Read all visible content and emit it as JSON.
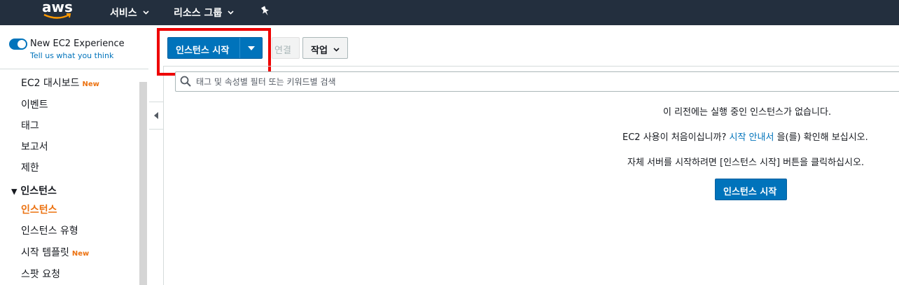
{
  "topnav": {
    "logo_text": "aws",
    "services_label": "서비스",
    "resource_groups_label": "리소스 그룹"
  },
  "sidebar": {
    "new_experience_label": "New EC2 Experience",
    "tell_us_label": "Tell us what you think",
    "items": [
      {
        "label": "EC2 대시보드",
        "badge": "New"
      },
      {
        "label": "이벤트"
      },
      {
        "label": "태그"
      },
      {
        "label": "보고서"
      },
      {
        "label": "제한"
      }
    ],
    "section_label": "인스턴스",
    "section_items": [
      {
        "label": "인스턴스",
        "active": true
      },
      {
        "label": "인스턴스 유형"
      },
      {
        "label": "시작 템플릿",
        "badge": "New"
      },
      {
        "label": "스팟 요청"
      }
    ]
  },
  "toolbar": {
    "launch_label": "인스턴스 시작",
    "connect_label": "연결",
    "actions_label": "작업"
  },
  "search": {
    "placeholder": "태그 및 속성별 필터 또는 키워드별 검색"
  },
  "empty_state": {
    "line1": "이 리전에는 실행 중인 인스턴스가 없습니다.",
    "line2_prefix": "EC2 사용이 처음이십니까? ",
    "line2_link": "시작 안내서",
    "line2_suffix": " 을(를) 확인해 보십시오.",
    "line3": "자체 서버를 시작하려면 [인스턴스 시작] 버튼을 클릭하십시오.",
    "button_label": "인스턴스 시작"
  },
  "colors": {
    "nav_bg": "#232f3e",
    "primary": "#0073bb",
    "active_orange": "#ec7211",
    "highlight_red": "#ee0000"
  }
}
